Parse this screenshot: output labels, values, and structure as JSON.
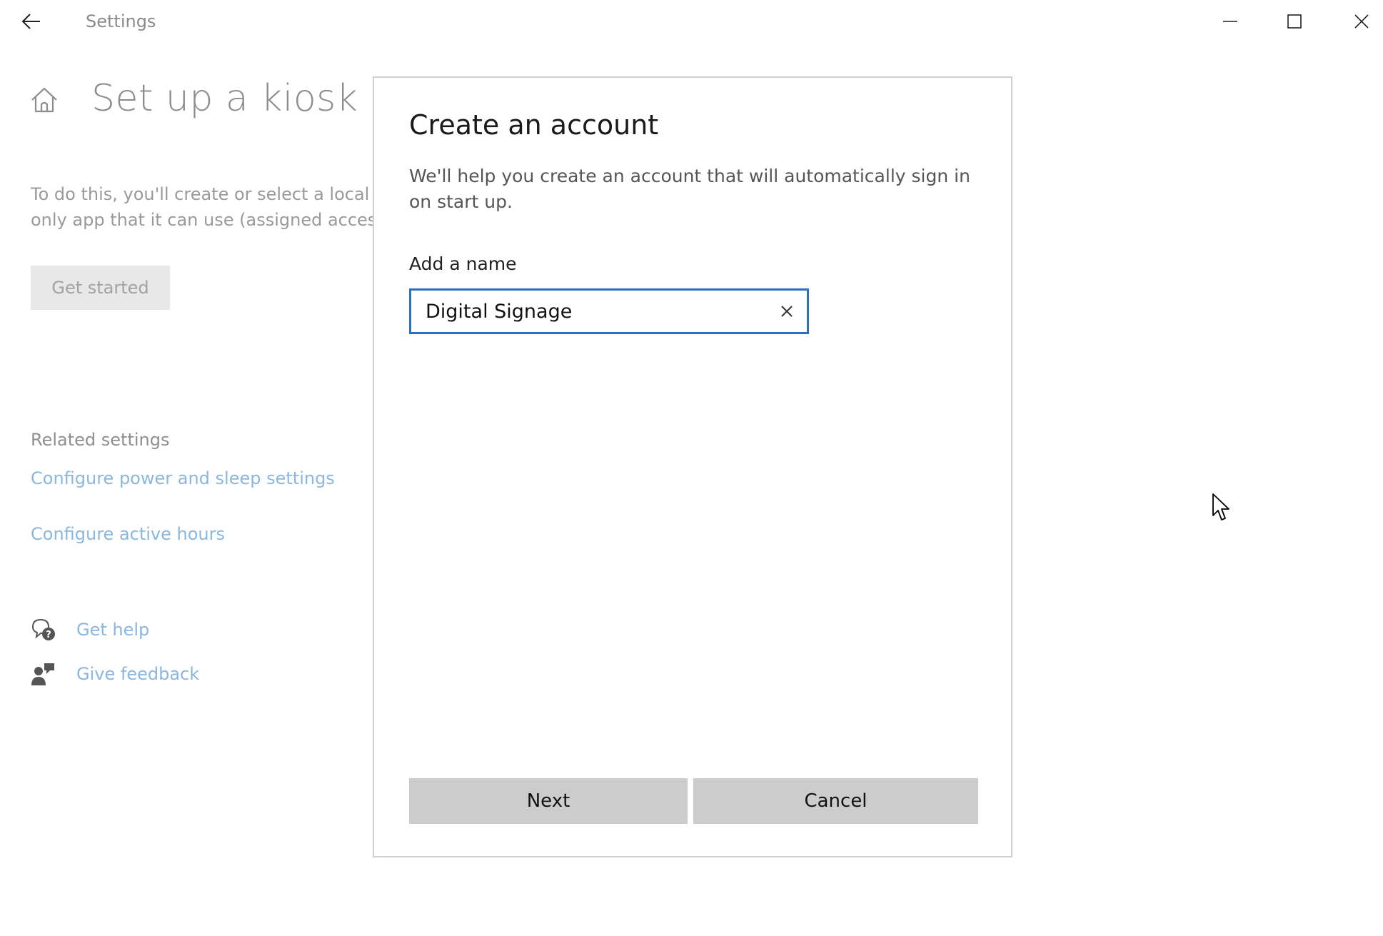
{
  "titlebar": {
    "app_title": "Settings",
    "back_icon": "arrow-left-icon",
    "minimize_icon": "minimize-icon",
    "maximize_icon": "maximize-icon",
    "close_icon": "close-icon"
  },
  "page": {
    "home_icon": "home-icon",
    "title": "Set up a kiosk",
    "description_line1": "To do this, you'll create or select a local",
    "description_line2": "only app that it can use (assigned acces",
    "get_started_label": "Get started",
    "related_heading": "Related settings",
    "links": {
      "power_sleep": "Configure power and sleep settings",
      "active_hours": "Configure active hours"
    },
    "help": {
      "get_help_label": "Get help",
      "get_help_icon": "help-chat-icon",
      "feedback_label": "Give feedback",
      "feedback_icon": "feedback-person-icon"
    },
    "link_color": "#8ab7df"
  },
  "dialog": {
    "title": "Create an account",
    "text": "We'll help you create an account that will automatically sign in on start up.",
    "name_label": "Add a name",
    "name_value": "Digital Signage",
    "clear_icon": "clear-x-icon",
    "next_label": "Next",
    "cancel_label": "Cancel",
    "accent_color": "#2a6ec6"
  }
}
